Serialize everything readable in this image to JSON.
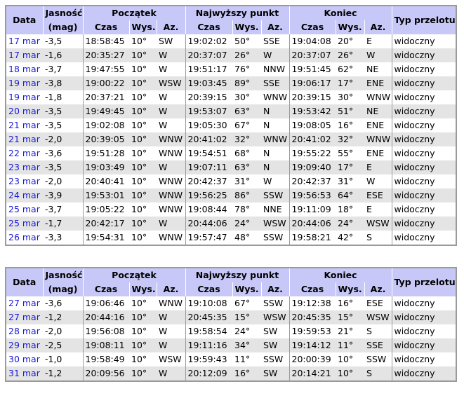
{
  "headers": {
    "data": "Data",
    "jasnosc": "Jasność",
    "mag": "(mag)",
    "poczatek": "Początek",
    "najwyzszy": "Najwyższy punkt",
    "koniec": "Koniec",
    "typ": "Typ przelotu",
    "czas": "Czas",
    "wys": "Wys.",
    "az": "Az."
  },
  "table1": [
    {
      "date": "17 mar",
      "mag": "-3,5",
      "s_time": "18:58:45",
      "s_alt": "10°",
      "s_az": "SW",
      "m_time": "19:02:02",
      "m_alt": "50°",
      "m_az": "SSE",
      "e_time": "19:04:08",
      "e_alt": "20°",
      "e_az": "E",
      "type": "widoczny"
    },
    {
      "date": "17 mar",
      "mag": "-1,6",
      "s_time": "20:35:27",
      "s_alt": "10°",
      "s_az": "W",
      "m_time": "20:37:07",
      "m_alt": "26°",
      "m_az": "W",
      "e_time": "20:37:07",
      "e_alt": "26°",
      "e_az": "W",
      "type": "widoczny"
    },
    {
      "date": "18 mar",
      "mag": "-3,7",
      "s_time": "19:47:55",
      "s_alt": "10°",
      "s_az": "W",
      "m_time": "19:51:17",
      "m_alt": "76°",
      "m_az": "NNW",
      "e_time": "19:51:45",
      "e_alt": "62°",
      "e_az": "NE",
      "type": "widoczny"
    },
    {
      "date": "19 mar",
      "mag": "-3,8",
      "s_time": "19:00:22",
      "s_alt": "10°",
      "s_az": "WSW",
      "m_time": "19:03:45",
      "m_alt": "89°",
      "m_az": "SSE",
      "e_time": "19:06:17",
      "e_alt": "17°",
      "e_az": "ENE",
      "type": "widoczny"
    },
    {
      "date": "19 mar",
      "mag": "-1,8",
      "s_time": "20:37:21",
      "s_alt": "10°",
      "s_az": "W",
      "m_time": "20:39:15",
      "m_alt": "30°",
      "m_az": "WNW",
      "e_time": "20:39:15",
      "e_alt": "30°",
      "e_az": "WNW",
      "type": "widoczny"
    },
    {
      "date": "20 mar",
      "mag": "-3,5",
      "s_time": "19:49:45",
      "s_alt": "10°",
      "s_az": "W",
      "m_time": "19:53:07",
      "m_alt": "63°",
      "m_az": "N",
      "e_time": "19:53:42",
      "e_alt": "51°",
      "e_az": "NE",
      "type": "widoczny"
    },
    {
      "date": "21 mar",
      "mag": "-3,5",
      "s_time": "19:02:08",
      "s_alt": "10°",
      "s_az": "W",
      "m_time": "19:05:30",
      "m_alt": "67°",
      "m_az": "N",
      "e_time": "19:08:05",
      "e_alt": "16°",
      "e_az": "ENE",
      "type": "widoczny"
    },
    {
      "date": "21 mar",
      "mag": "-2,0",
      "s_time": "20:39:05",
      "s_alt": "10°",
      "s_az": "WNW",
      "m_time": "20:41:02",
      "m_alt": "32°",
      "m_az": "WNW",
      "e_time": "20:41:02",
      "e_alt": "32°",
      "e_az": "WNW",
      "type": "widoczny"
    },
    {
      "date": "22 mar",
      "mag": "-3,6",
      "s_time": "19:51:28",
      "s_alt": "10°",
      "s_az": "WNW",
      "m_time": "19:54:51",
      "m_alt": "68°",
      "m_az": "N",
      "e_time": "19:55:22",
      "e_alt": "55°",
      "e_az": "ENE",
      "type": "widoczny"
    },
    {
      "date": "23 mar",
      "mag": "-3,5",
      "s_time": "19:03:49",
      "s_alt": "10°",
      "s_az": "W",
      "m_time": "19:07:11",
      "m_alt": "63°",
      "m_az": "N",
      "e_time": "19:09:40",
      "e_alt": "17°",
      "e_az": "E",
      "type": "widoczny"
    },
    {
      "date": "23 mar",
      "mag": "-2,0",
      "s_time": "20:40:41",
      "s_alt": "10°",
      "s_az": "WNW",
      "m_time": "20:42:37",
      "m_alt": "31°",
      "m_az": "W",
      "e_time": "20:42:37",
      "e_alt": "31°",
      "e_az": "W",
      "type": "widoczny"
    },
    {
      "date": "24 mar",
      "mag": "-3,9",
      "s_time": "19:53:01",
      "s_alt": "10°",
      "s_az": "WNW",
      "m_time": "19:56:25",
      "m_alt": "86°",
      "m_az": "SSW",
      "e_time": "19:56:53",
      "e_alt": "64°",
      "e_az": "ESE",
      "type": "widoczny"
    },
    {
      "date": "25 mar",
      "mag": "-3,7",
      "s_time": "19:05:22",
      "s_alt": "10°",
      "s_az": "WNW",
      "m_time": "19:08:44",
      "m_alt": "78°",
      "m_az": "NNE",
      "e_time": "19:11:09",
      "e_alt": "18°",
      "e_az": "E",
      "type": "widoczny"
    },
    {
      "date": "25 mar",
      "mag": "-1,7",
      "s_time": "20:42:17",
      "s_alt": "10°",
      "s_az": "W",
      "m_time": "20:44:06",
      "m_alt": "24°",
      "m_az": "WSW",
      "e_time": "20:44:06",
      "e_alt": "24°",
      "e_az": "WSW",
      "type": "widoczny"
    },
    {
      "date": "26 mar",
      "mag": "-3,3",
      "s_time": "19:54:31",
      "s_alt": "10°",
      "s_az": "WNW",
      "m_time": "19:57:47",
      "m_alt": "48°",
      "m_az": "SSW",
      "e_time": "19:58:21",
      "e_alt": "42°",
      "e_az": "S",
      "type": "widoczny"
    }
  ],
  "table2": [
    {
      "date": "27 mar",
      "mag": "-3,6",
      "s_time": "19:06:46",
      "s_alt": "10°",
      "s_az": "WNW",
      "m_time": "19:10:08",
      "m_alt": "67°",
      "m_az": "SSW",
      "e_time": "19:12:38",
      "e_alt": "16°",
      "e_az": "ESE",
      "type": "widoczny"
    },
    {
      "date": "27 mar",
      "mag": "-1,2",
      "s_time": "20:44:16",
      "s_alt": "10°",
      "s_az": "W",
      "m_time": "20:45:35",
      "m_alt": "15°",
      "m_az": "WSW",
      "e_time": "20:45:35",
      "e_alt": "15°",
      "e_az": "WSW",
      "type": "widoczny"
    },
    {
      "date": "28 mar",
      "mag": "-2,0",
      "s_time": "19:56:08",
      "s_alt": "10°",
      "s_az": "W",
      "m_time": "19:58:54",
      "m_alt": "24°",
      "m_az": "SW",
      "e_time": "19:59:53",
      "e_alt": "21°",
      "e_az": "S",
      "type": "widoczny"
    },
    {
      "date": "29 mar",
      "mag": "-2,5",
      "s_time": "19:08:11",
      "s_alt": "10°",
      "s_az": "W",
      "m_time": "19:11:16",
      "m_alt": "34°",
      "m_az": "SW",
      "e_time": "19:14:12",
      "e_alt": "11°",
      "e_az": "SSE",
      "type": "widoczny"
    },
    {
      "date": "30 mar",
      "mag": "-1,0",
      "s_time": "19:58:49",
      "s_alt": "10°",
      "s_az": "WSW",
      "m_time": "19:59:43",
      "m_alt": "11°",
      "m_az": "SSW",
      "e_time": "20:00:39",
      "e_alt": "10°",
      "e_az": "SSW",
      "type": "widoczny"
    },
    {
      "date": "31 mar",
      "mag": "-1,2",
      "s_time": "20:09:56",
      "s_alt": "10°",
      "s_az": "W",
      "m_time": "20:12:09",
      "m_alt": "16°",
      "m_az": "SW",
      "e_time": "20:14:21",
      "e_alt": "10°",
      "e_az": "S",
      "type": "widoczny"
    }
  ]
}
